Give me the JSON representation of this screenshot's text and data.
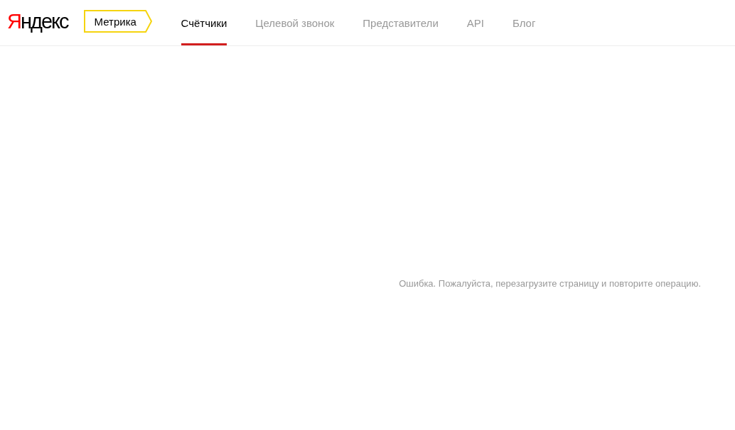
{
  "header": {
    "logo": "Яндекс",
    "service": "Метрика",
    "tabs": [
      {
        "label": "Счётчики",
        "selected": true
      },
      {
        "label": "Целевой звонок",
        "selected": false
      },
      {
        "label": "Представители",
        "selected": false
      },
      {
        "label": "API",
        "selected": false
      },
      {
        "label": "Блог",
        "selected": false
      }
    ]
  },
  "error_message": "Ошибка. Пожалуйста, перезагрузите страницу и повторите операцию."
}
